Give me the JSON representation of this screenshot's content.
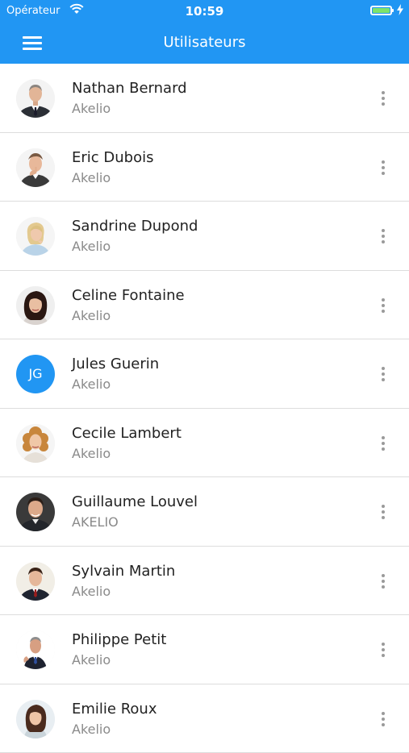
{
  "status_bar": {
    "carrier": "Opérateur",
    "time": "10:59"
  },
  "header": {
    "title": "Utilisateurs"
  },
  "colors": {
    "primary": "#2196F3",
    "battery": "#7ee36b"
  },
  "users": [
    {
      "name": "Nathan Bernard",
      "company": "Akelio",
      "photo": "man-suit"
    },
    {
      "name": "Eric Dubois",
      "company": "Akelio",
      "photo": "man-thinking"
    },
    {
      "name": "Sandrine Dupond",
      "company": "Akelio",
      "photo": "woman-blonde"
    },
    {
      "name": "Celine Fontaine",
      "company": "Akelio",
      "photo": "woman-dark"
    },
    {
      "name": "Jules Guerin",
      "company": "Akelio",
      "initials": "JG"
    },
    {
      "name": "Cecile Lambert",
      "company": "Akelio",
      "photo": "woman-curly"
    },
    {
      "name": "Guillaume Louvel",
      "company": "AKELIO",
      "photo": "man-dark-bg"
    },
    {
      "name": "Sylvain Martin",
      "company": "Akelio",
      "photo": "man-young"
    },
    {
      "name": "Philippe Petit",
      "company": "Akelio",
      "photo": "man-older"
    },
    {
      "name": "Emilie Roux",
      "company": "Akelio",
      "photo": "woman-brunette"
    }
  ]
}
